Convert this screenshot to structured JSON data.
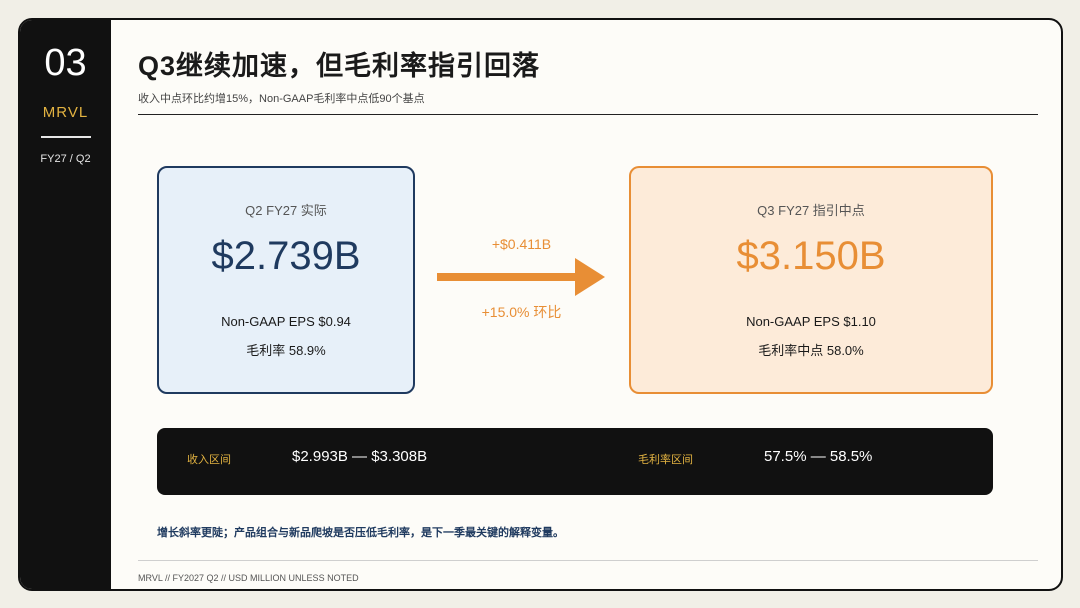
{
  "sidebar": {
    "section_number": "03",
    "ticker": "MRVL",
    "period": "FY27 / Q2"
  },
  "header": {
    "title": "Q3继续加速，但毛利率指引回落",
    "subtitle": "收入中点环比约增15%，Non-GAAP毛利率中点低90个基点"
  },
  "actual_card": {
    "label": "Q2 FY27 实际",
    "revenue": "$2.739B",
    "eps_line": "Non-GAAP EPS  $0.94",
    "margin_line": "毛利率  58.9%"
  },
  "change": {
    "amount": "+$0.411B",
    "percent": "+15.0% 环比"
  },
  "guidance_card": {
    "label": "Q3 FY27 指引中点",
    "revenue": "$3.150B",
    "eps_line": "Non-GAAP EPS  $1.10",
    "margin_line": "毛利率中点  58.0%"
  },
  "ranges": {
    "revenue_label": "收入区间",
    "revenue_range": "$2.993B — $3.308B",
    "margin_label": "毛利率区间",
    "margin_range": "57.5% — 58.5%"
  },
  "note": "增长斜率更陡；产品组合与新品爬坡是否压低毛利率，是下一季最关键的解释变量。",
  "footer": "MRVL // FY2027 Q2 // USD MILLION UNLESS NOTED",
  "colors": {
    "navy": "#1f3a5f",
    "orange": "#e88e35",
    "gold": "#e3b341",
    "dark": "#111111"
  }
}
